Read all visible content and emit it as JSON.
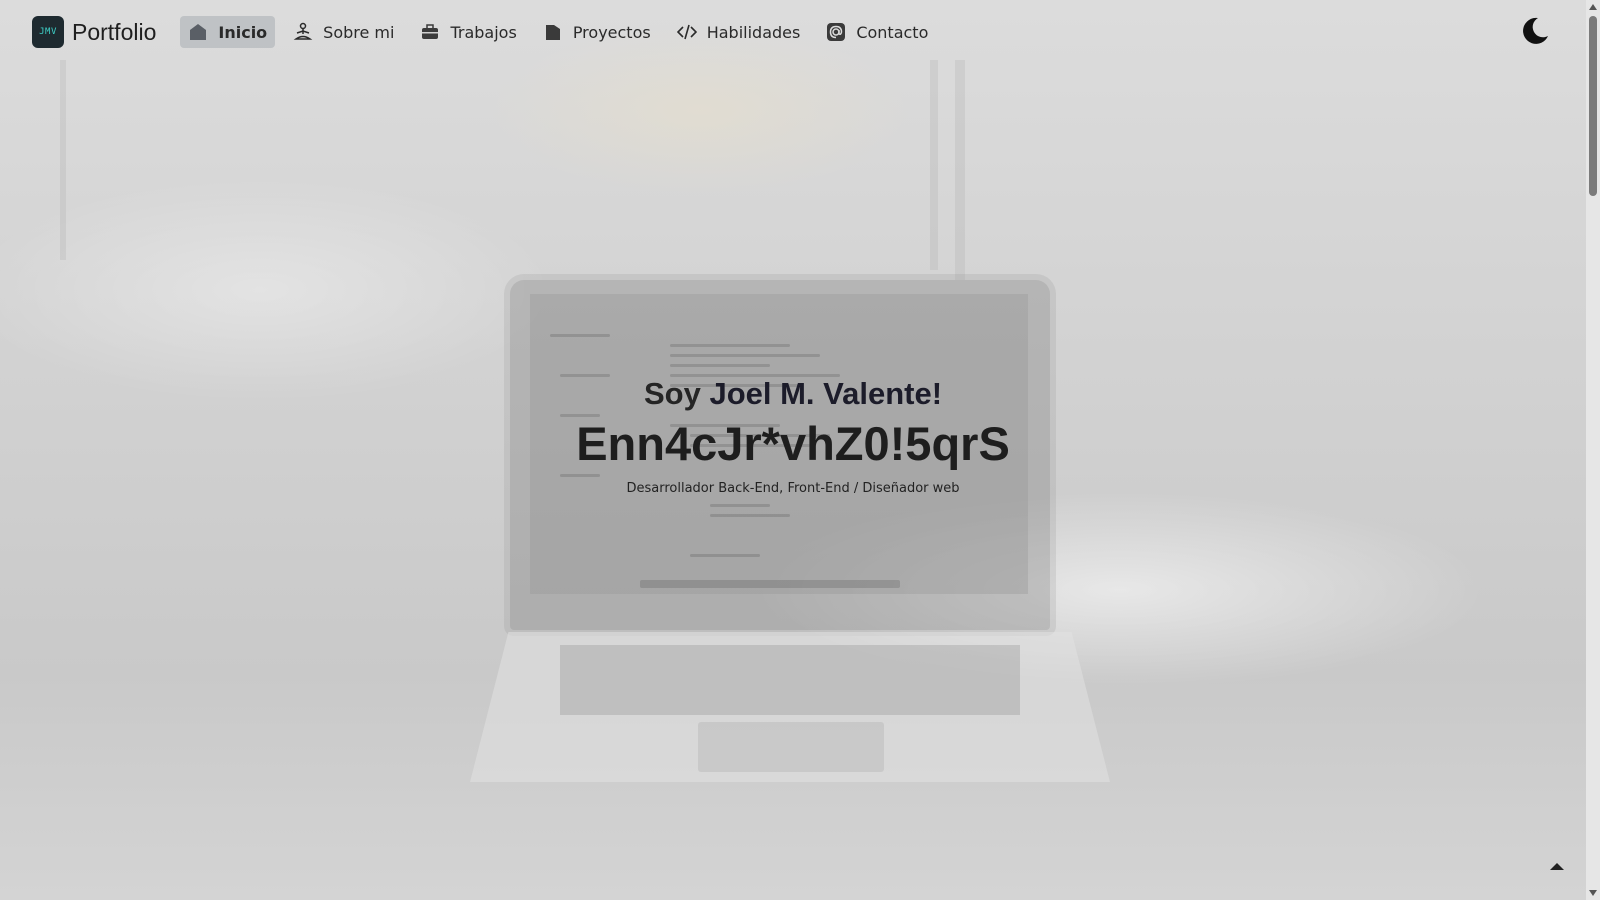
{
  "brand": {
    "logo_text": "JMV",
    "title": "Portfolio"
  },
  "nav": {
    "items": [
      {
        "label": "Inicio",
        "icon": "home-icon",
        "active": true
      },
      {
        "label": "Sobre mi",
        "icon": "person-meditating-icon",
        "active": false
      },
      {
        "label": "Trabajos",
        "icon": "briefcase-icon",
        "active": false
      },
      {
        "label": "Proyectos",
        "icon": "folder-icon",
        "active": false
      },
      {
        "label": "Habilidades",
        "icon": "code-icon",
        "active": false
      },
      {
        "label": "Contacto",
        "icon": "at-sign-icon",
        "active": false
      }
    ]
  },
  "theme_toggle": {
    "icon": "moon-icon"
  },
  "hero": {
    "greeting_prefix": "Soy",
    "name": "Joel M. Valente!",
    "animated_text": "Enn4cJr*vhZ0!5qrS",
    "subtitle": "Desarrollador Back-End, Front-End / Diseñador web"
  },
  "scroll_to_top": {
    "icon": "arrow-up-icon"
  },
  "colors": {
    "accent": "#3fd0c8",
    "logo_bg": "#1e2a30",
    "active_bg": "#b8bdc2"
  }
}
